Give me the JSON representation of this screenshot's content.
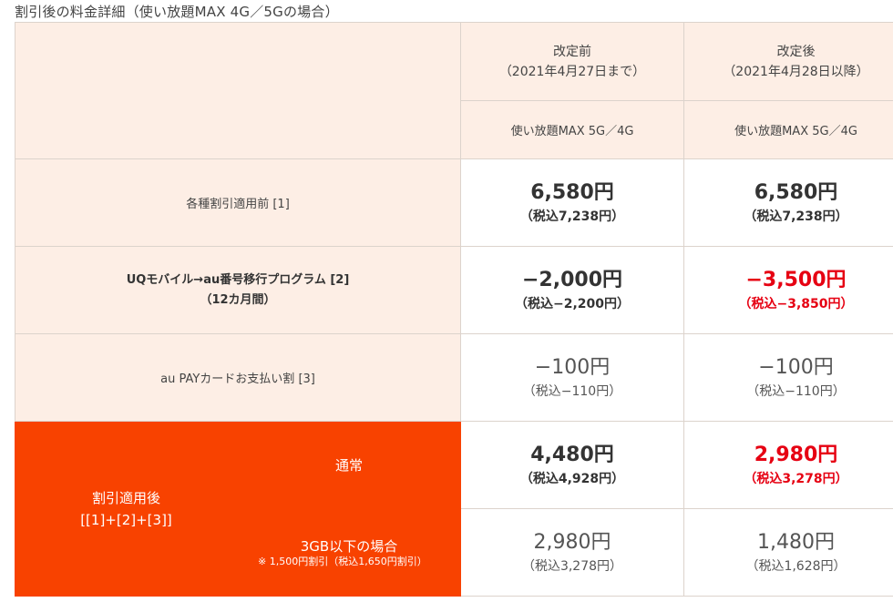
{
  "caption": "割引後の料金詳細（使い放題MAX 4G／5Gの場合）",
  "headers": {
    "before": {
      "title": "改定前",
      "date": "（2021年4月27日まで）",
      "plan": "使い放題MAX 5G／4G"
    },
    "after": {
      "title": "改定後",
      "date": "（2021年4月28日以降）",
      "plan": "使い放題MAX 5G／4G"
    }
  },
  "rows": {
    "base": {
      "label": "各種割引適用前 [1]",
      "before_price": "6,580円",
      "before_tax": "（税込7,238円）",
      "after_price": "6,580円",
      "after_tax": "（税込7,238円）"
    },
    "mnp": {
      "label_line1": "UQモバイル→au番号移行プログラム [2]",
      "label_line2": "（12カ月間）",
      "before_price": "−2,000円",
      "before_tax": "（税込−2,200円）",
      "after_price": "−3,500円",
      "after_tax": "（税込−3,850円）"
    },
    "card": {
      "label": "au PAYカードお支払い割 [3]",
      "before_price": "−100円",
      "before_tax": "（税込−110円）",
      "after_price": "−100円",
      "after_tax": "（税込−110円）"
    },
    "after_discount": {
      "label_line1": "割引適用後",
      "label_line2": "[[1]+[2]+[3]]",
      "normal": {
        "label": "通常",
        "before_price": "4,480円",
        "before_tax": "（税込4,928円）",
        "after_price": "2,980円",
        "after_tax": "（税込3,278円）"
      },
      "lite": {
        "label": "3GB以下の場合",
        "note": "※ 1,500円割引（税込1,650円割引）",
        "before_price": "2,980円",
        "before_tax": "（税込3,278円）",
        "after_price": "1,480円",
        "after_tax": "（税込1,628円）"
      }
    }
  },
  "colors": {
    "accent_orange": "#f84200",
    "highlight_red": "#e60012",
    "beige": "#fdeee5"
  }
}
